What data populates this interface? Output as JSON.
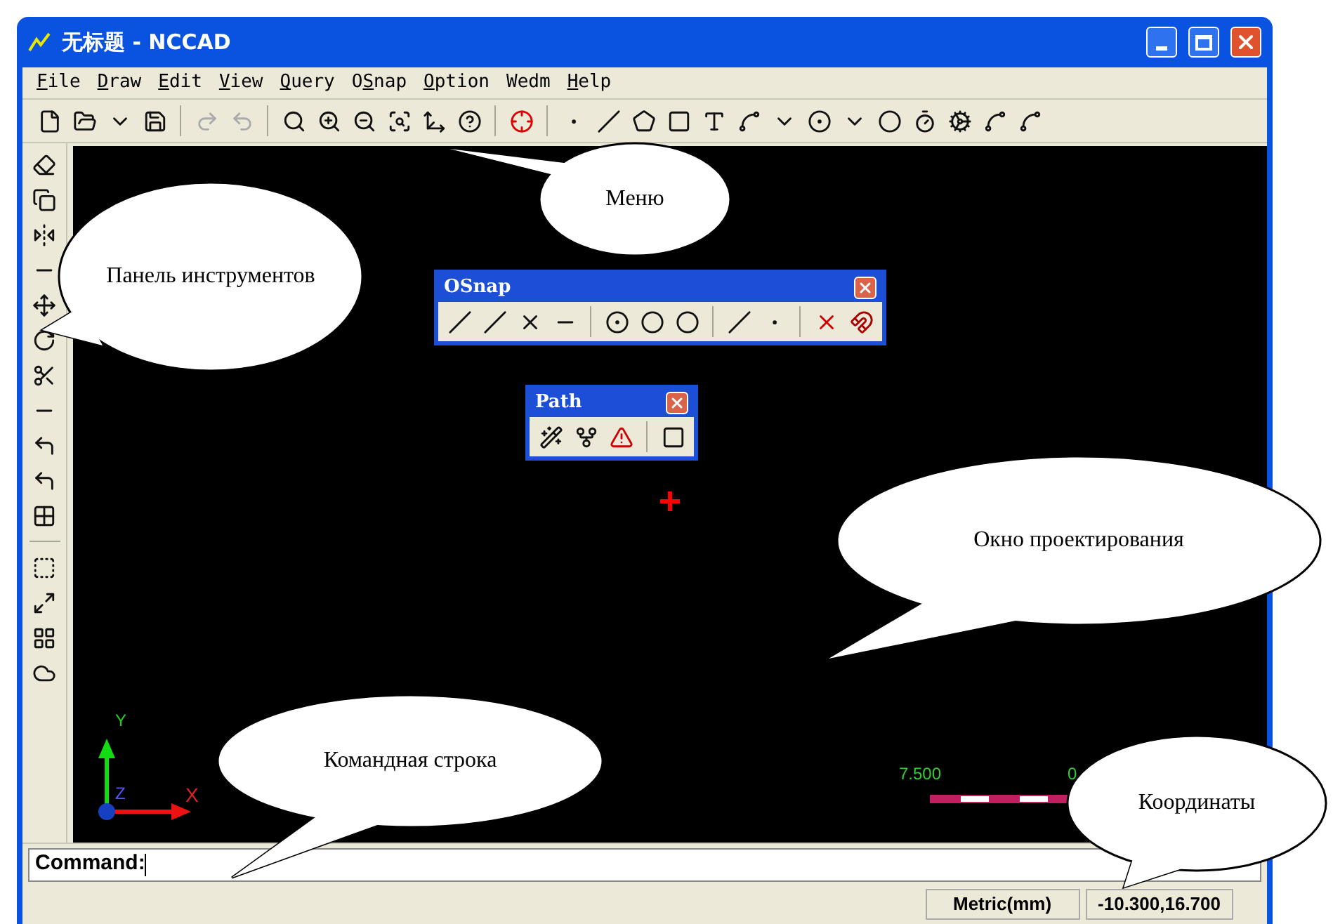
{
  "window": {
    "title": "无标题 - NCCAD"
  },
  "menu": [
    {
      "key": "F",
      "after": "ile"
    },
    {
      "key": "D",
      "after": "raw"
    },
    {
      "key": "E",
      "after": "dit"
    },
    {
      "key": "V",
      "after": "iew"
    },
    {
      "key": "Q",
      "after": "uery"
    },
    {
      "before": "O",
      "key": "S",
      "after": "nap"
    },
    {
      "key": "O",
      "after": "ption"
    },
    {
      "before": "Wedm"
    },
    {
      "key": "H",
      "after": "elp"
    }
  ],
  "floating_toolbars": [
    {
      "title": "OSnap"
    },
    {
      "title": "Path"
    }
  ],
  "canvas": {
    "axis_labels": [
      "Y",
      "Z",
      "X"
    ],
    "scale_labels": [
      "7.500",
      "0"
    ]
  },
  "command": {
    "label": "Command:"
  },
  "status_bar": [
    "Metric(mm)",
    "-10.300,16.700"
  ],
  "callouts": [
    {
      "text": "Меню"
    },
    {
      "text": "Панель инструментов"
    },
    {
      "text": "Окно проектирования"
    },
    {
      "text": "Командная строка"
    },
    {
      "text": "Координаты"
    }
  ]
}
